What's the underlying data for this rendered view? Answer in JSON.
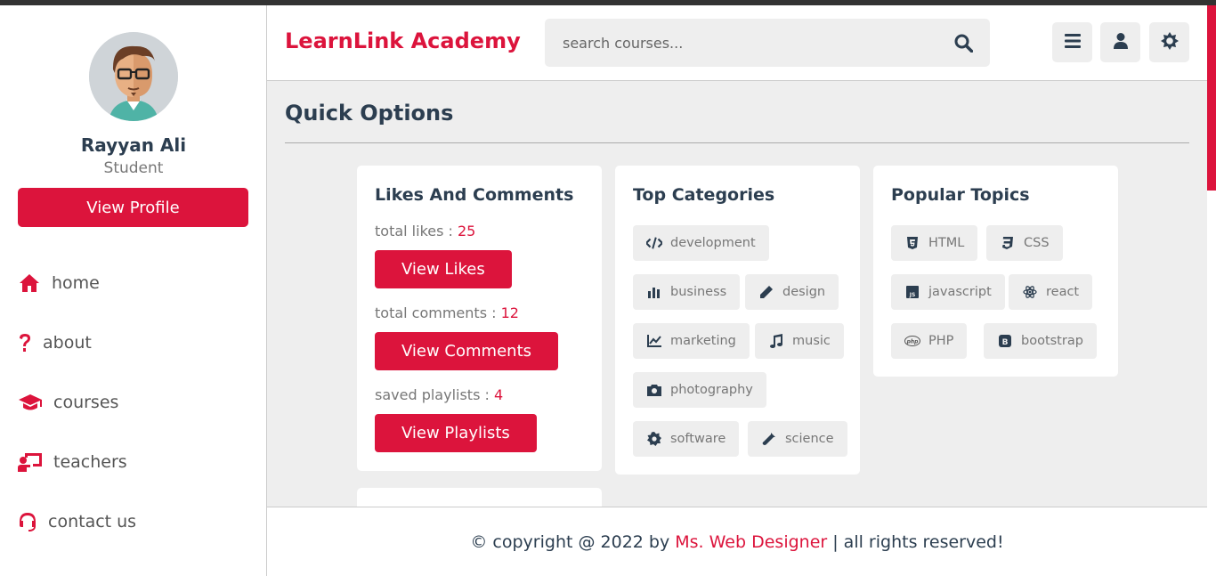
{
  "header": {
    "logo": "LearnLink Academy",
    "search_placeholder": "search courses..."
  },
  "profile": {
    "name": "Rayyan Ali",
    "role": "Student",
    "view_profile_label": "View Profile"
  },
  "nav": {
    "items": [
      {
        "label": "home",
        "icon": "home-icon"
      },
      {
        "label": "about",
        "icon": "question-icon"
      },
      {
        "label": "courses",
        "icon": "graduation-cap-icon"
      },
      {
        "label": "teachers",
        "icon": "chalkboard-teacher-icon"
      },
      {
        "label": "contact us",
        "icon": "headset-icon"
      }
    ]
  },
  "main": {
    "title": "Quick Options",
    "likes_card": {
      "title": "Likes And Comments",
      "likes_label": "total likes : ",
      "likes_value": "25",
      "likes_btn": "View Likes",
      "comments_label": "total comments : ",
      "comments_value": "12",
      "comments_btn": "View Comments",
      "playlists_label": "saved playlists : ",
      "playlists_value": "4",
      "playlists_btn": "View Playlists"
    },
    "categories_card": {
      "title": "Top Categories",
      "tags": [
        "development",
        "business",
        "design",
        "marketing",
        "music",
        "photography",
        "software",
        "science"
      ]
    },
    "topics_card": {
      "title": "Popular Topics",
      "tags": [
        "HTML",
        "CSS",
        "javascript",
        "react",
        "PHP",
        "bootstrap"
      ]
    }
  },
  "footer": {
    "prefix": "© copyright @ 2022 by ",
    "brand": "Ms. Web Designer",
    "suffix": " | all rights reserved!"
  },
  "colors": {
    "accent": "#dc143c",
    "text_dark": "#2c3e50",
    "background": "#eeeeee"
  }
}
